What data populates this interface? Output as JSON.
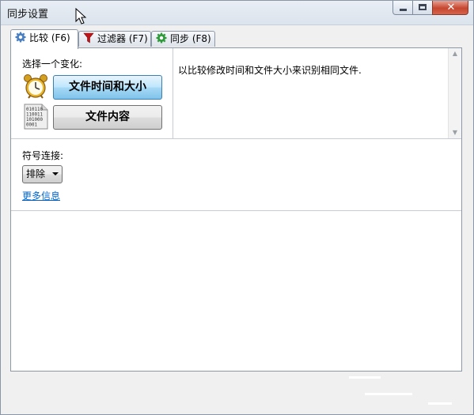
{
  "window": {
    "title": "同步设置"
  },
  "tabs": [
    {
      "label": "比较 (F6)",
      "icon": "gear-icon",
      "active": true
    },
    {
      "label": "过滤器 (F7)",
      "icon": "funnel-icon",
      "active": false
    },
    {
      "label": "同步 (F8)",
      "icon": "gear-green-icon",
      "active": false
    }
  ],
  "compare": {
    "variant_label": "选择一个变化:",
    "buttons": [
      {
        "label": "文件时间和大小",
        "icon": "alarm-clock-icon",
        "selected": true
      },
      {
        "label": "文件内容",
        "icon": "binary-file-icon",
        "selected": false
      }
    ],
    "description": "以比较修改时间和文件大小来识别相同文件.",
    "binary_glyph": [
      "010110",
      "110011",
      "101000",
      "0001"
    ],
    "symlink_label": "符号连接:",
    "symlink_value": "排除",
    "more_info": "更多信息"
  },
  "colors": {
    "accent_button": "#bde6fd",
    "link": "#0066cc",
    "close_button": "#c6472f"
  }
}
